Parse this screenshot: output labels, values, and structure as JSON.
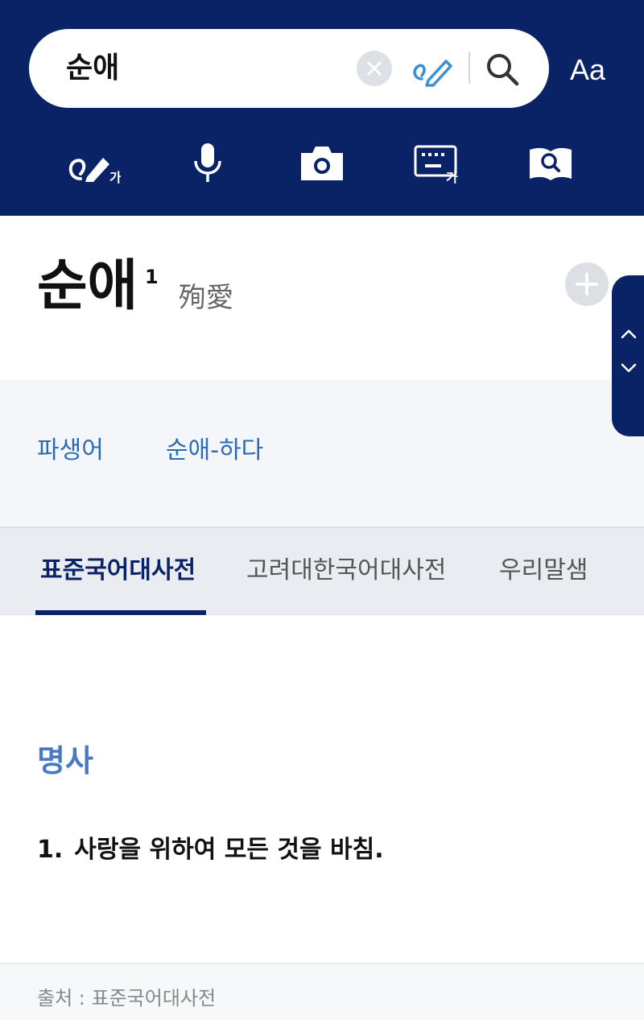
{
  "search": {
    "query": "순애",
    "font_size_label": "Aa"
  },
  "entry": {
    "word": "순애",
    "homonym_number": "1",
    "hanja": "殉愛"
  },
  "derivative": {
    "label": "파생어",
    "link": "순애-하다"
  },
  "tabs": [
    {
      "label": "표준국어대사전",
      "active": true
    },
    {
      "label": "고려대한국어대사전",
      "active": false
    },
    {
      "label": "우리말샘",
      "active": false
    }
  ],
  "definition": {
    "part_of_speech": "명사",
    "senses": [
      {
        "number": "1.",
        "text": "사랑을 위하여 모든 것을 바침."
      }
    ]
  },
  "footer": {
    "source": "출처 : 표준국어대사전"
  },
  "colors": {
    "header_bg": "#0a2266",
    "link": "#2a6bb3",
    "part_of_speech": "#4a79c4"
  }
}
